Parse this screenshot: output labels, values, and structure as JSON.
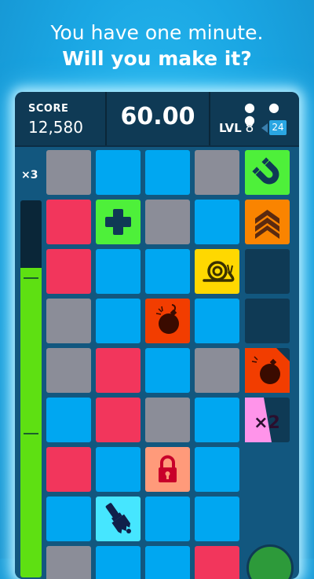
{
  "headline": {
    "line1": "You have one minute.",
    "line2": "Will you make it?"
  },
  "hud": {
    "score_label": "SCORE",
    "score_value": "12,580",
    "timer": "60.00",
    "menu_icon": "more-dots-icon",
    "level_label": "LVL",
    "level_value": "8",
    "level_target": "24"
  },
  "multiplier": "×3",
  "meter_level": 0.82,
  "powerups": {
    "double": "×2"
  },
  "colors": {
    "blue": "#00a7f1",
    "gray": "#8b8d98",
    "red": "#f2365c",
    "green": "#5ee012"
  }
}
